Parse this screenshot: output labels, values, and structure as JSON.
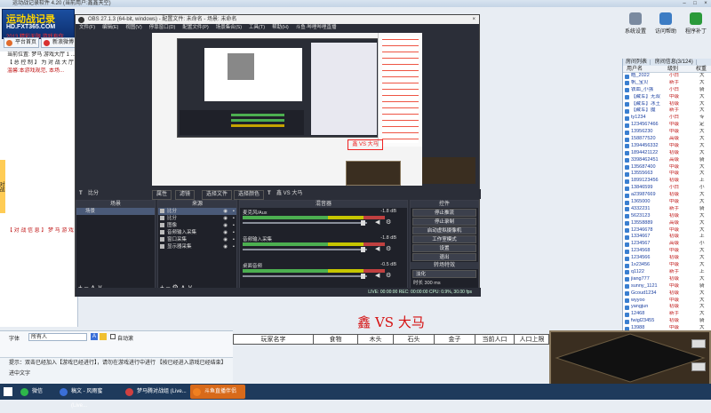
{
  "window": {
    "title": "运动战记录软件 4.20 (当前用户:鑫鑫天空)"
  },
  "logo": {
    "line1": "运动战记录",
    "line2": "HD.FXT365.COM",
    "line3": "2013 精彩无限 游戏有你"
  },
  "topbar": {
    "home_label": "平台首页",
    "new_label": "新浪微博"
  },
  "left_panel": {
    "lines": [
      "当前位置: 梦马 游戏大厅 1 ...",
      "【 总 控 制 】 为 对 战 大 厅 ...",
      "温馨:本游戏规范, 本场...",
      "",
      "",
      "",
      "",
      "",
      "",
      "",
      "",
      "",
      "",
      "",
      "",
      "",
      "",
      "",
      "",
      "",
      "",
      "",
      "【 对 战 信 息 】 梦 马 游 戏 大 厅 系 统 ..."
    ],
    "side_tab": "对战"
  },
  "tools": [
    {
      "label": "系统设置",
      "color": "#7a8aa0"
    },
    {
      "label": "访问帮助",
      "color": "#3c7cc4"
    },
    {
      "label": "程序补丁",
      "color": "#2a9a3a"
    }
  ],
  "right_panel": {
    "tabs": [
      "房间列表",
      "房间信息(3/124)"
    ],
    "headers": {
      "name": "用户名",
      "level": "级别",
      "weight": "权重"
    },
    "rows": [
      {
        "name": "皓_2022",
        "level": "小白",
        "weight": "大"
      },
      {
        "name": "帆_宝贝",
        "level": "新手",
        "weight": "大"
      },
      {
        "name": "铁血_小强",
        "level": "小白",
        "weight": "骑"
      },
      {
        "name": "【藏军】无双",
        "level": "中级",
        "weight": "大"
      },
      {
        "name": "【藏军】冰王",
        "level": "初级",
        "weight": "大"
      },
      {
        "name": "【藏军】魔",
        "level": "新手",
        "weight": "大"
      },
      {
        "name": "ty1234",
        "level": "小白",
        "weight": "专"
      },
      {
        "name": "1234567466",
        "level": "中级",
        "weight": "定"
      },
      {
        "name": "13956230",
        "level": "中级",
        "weight": "大"
      },
      {
        "name": "158877520",
        "level": "高级",
        "weight": "大"
      },
      {
        "name": "1394456332",
        "level": "中级",
        "weight": "大"
      },
      {
        "name": "1894421122",
        "level": "初级",
        "weight": "大"
      },
      {
        "name": "3398462451",
        "level": "高级",
        "weight": "骑"
      },
      {
        "name": "135687400",
        "level": "中级",
        "weight": "大"
      },
      {
        "name": "13555663",
        "level": "中级",
        "weight": "大"
      },
      {
        "name": "1899123456",
        "level": "初级",
        "weight": "上"
      },
      {
        "name": "13846599",
        "level": "小白",
        "weight": "小"
      },
      {
        "name": "a23987669",
        "level": "初级",
        "weight": "大"
      },
      {
        "name": "1365000",
        "level": "中级",
        "weight": "大"
      },
      {
        "name": "4332231",
        "level": "新手",
        "weight": "骑"
      },
      {
        "name": "5623123",
        "level": "初级",
        "weight": "大"
      },
      {
        "name": "13558889",
        "level": "高级",
        "weight": "大"
      },
      {
        "name": "12346678",
        "level": "中级",
        "weight": "大"
      },
      {
        "name": "1334667",
        "level": "初级",
        "weight": "上"
      },
      {
        "name": "1234567",
        "level": "高级",
        "weight": "小"
      },
      {
        "name": "1234568",
        "level": "中级",
        "weight": "大"
      },
      {
        "name": "1234566",
        "level": "初级",
        "weight": "大"
      },
      {
        "name": "1x23456",
        "level": "中级",
        "weight": "大"
      },
      {
        "name": "q1122",
        "level": "新手",
        "weight": "上"
      },
      {
        "name": "jiang777",
        "level": "初级",
        "weight": "大"
      },
      {
        "name": "sunny_1121",
        "level": "中级",
        "weight": "骑"
      },
      {
        "name": "Gcoud1234",
        "level": "初级",
        "weight": "大"
      },
      {
        "name": "wyyoo",
        "level": "中级",
        "weight": "大"
      },
      {
        "name": "yangjun",
        "level": "初级",
        "weight": "大"
      },
      {
        "name": "12468",
        "level": "新手",
        "weight": "大"
      },
      {
        "name": "fwigl23455",
        "level": "初级",
        "weight": "骑"
      },
      {
        "name": "13988",
        "level": "中级",
        "weight": "大"
      },
      {
        "name": "jhuy",
        "level": "小白",
        "weight": "大"
      }
    ]
  },
  "obs": {
    "title": "OBS 27.1.3 (64-bit, windows) - 配置文件: 未命名 - 场景: 未命名",
    "menu": [
      "文件(F)",
      "编辑(E)",
      "视图(V)",
      "停靠窗口(D)",
      "配置文件(P)",
      "场景集合(S)",
      "工具(T)",
      "帮助(H)",
      "斗鱼·哔哩哔哩直播"
    ],
    "source_bar": {
      "source": "比分",
      "props": "属性",
      "filters": "滤镜",
      "select_file": "选择文件",
      "select_color": "选择颜色",
      "preview_text": "鑫 VS 大马"
    },
    "scenes": {
      "title": "场景",
      "items": [
        "场景"
      ]
    },
    "sources": {
      "title": "来源",
      "items": [
        "比分",
        "比分",
        "图像",
        "音频输入采集",
        "窗口采集",
        "显示器采集"
      ]
    },
    "mixer": {
      "title": "混音器",
      "tracks": [
        {
          "name": "麦克风/Aux",
          "db": "-1.8 dB"
        },
        {
          "name": "音频输入采集",
          "db": "-1.8 dB"
        },
        {
          "name": "桌面音频",
          "db": "-0.5 dB"
        }
      ]
    },
    "controls": {
      "title": "控件",
      "buttons": [
        "停止推流",
        "停止录制",
        "启动虚拟摄像机",
        "工作室模式",
        "设置",
        "退出"
      ]
    },
    "transition": {
      "title": "转场特效",
      "type": "淡化",
      "duration_label": "时长",
      "duration": "300 ms"
    },
    "status": "LIVE: 00:00:00   REC: 00:00:00   CPU: 0.9%, 30.00 fps"
  },
  "chat": {
    "font_label": "字体",
    "select_value": "所有人",
    "checkbox_label": "自动滚"
  },
  "tips": "提示：双击已经加入【游戏已经进行】，请勿在游戏进行中进行 【按已经进入游戏已经结束】 进中文字",
  "match": {
    "title": "鑫 VS 大马",
    "columns": [
      "玩家名字",
      "食物",
      "木头",
      "石头",
      "金子",
      "当前人口",
      "人口上限"
    ]
  },
  "taskbar": {
    "items": [
      {
        "label": "微信",
        "color": "#2eb84a"
      },
      {
        "label": "稿文 - 风雨蜜 (Live...",
        "color": "#3a6fd8"
      },
      {
        "label": "梦马腾对战组 (Live...",
        "color": "#d04040"
      },
      {
        "label": "斗鱼直播伴侣",
        "color": "#f08020"
      }
    ]
  }
}
